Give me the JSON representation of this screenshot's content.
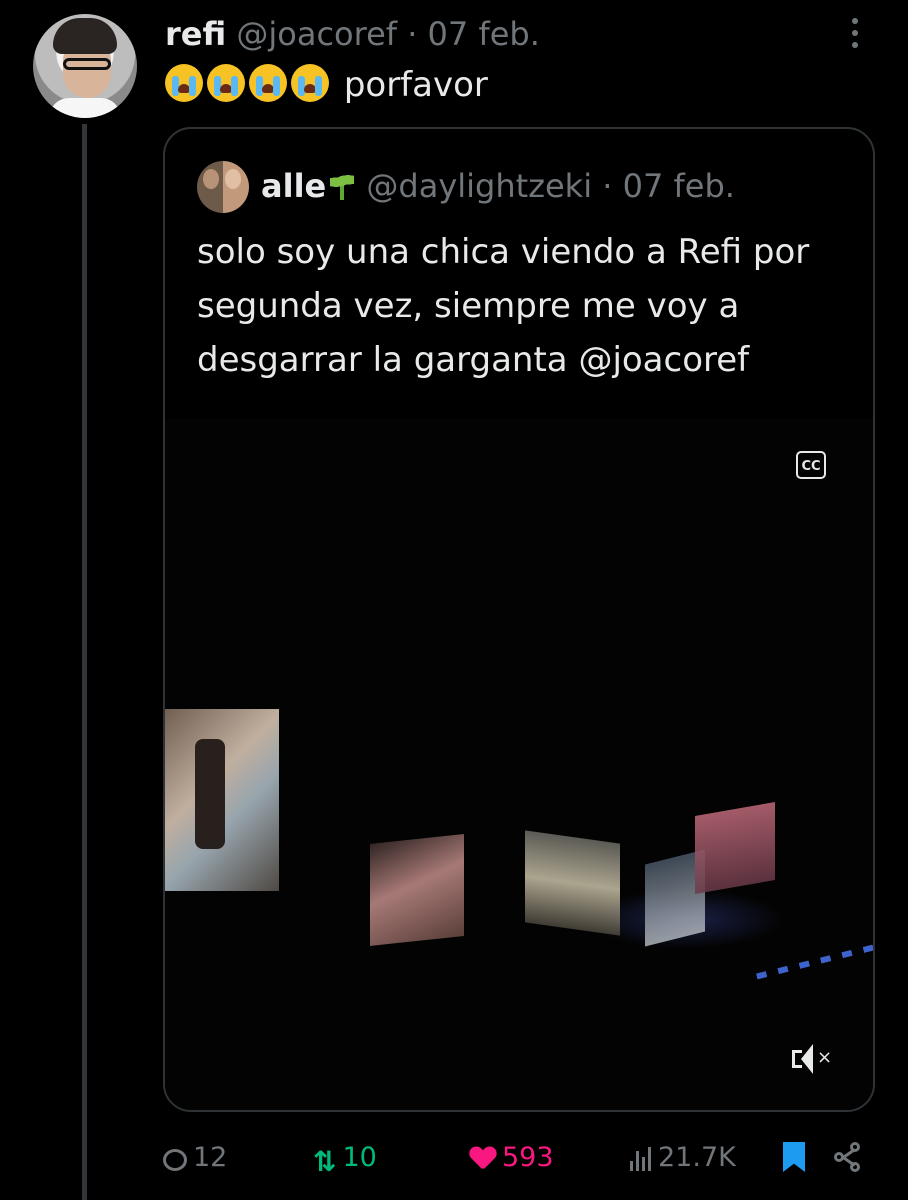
{
  "tweet": {
    "author_name": "refi",
    "author_handle": "@joacoref",
    "separator": "·",
    "date": "07 feb.",
    "text": "porfavor",
    "emoji_count": 4,
    "avatar_icon": "user-avatar"
  },
  "quote": {
    "author_name": "alle",
    "author_handle": "@daylightzeki",
    "separator": "·",
    "date": "07 feb.",
    "text": "solo soy una chica viendo a Refi por segunda vez, siempre me voy a desgarrar la garganta @joacoref",
    "video": {
      "captions_label": "CC",
      "muted": true
    }
  },
  "actions": {
    "replies": "12",
    "retweets": "10",
    "likes": "593",
    "views": "21.7K",
    "bookmarked": true
  },
  "colors": {
    "background": "#000000",
    "text": "#e7e9ea",
    "secondary": "#71767b",
    "retweet": "#00ba7c",
    "like": "#f91880",
    "bookmark": "#1d9bf0"
  }
}
